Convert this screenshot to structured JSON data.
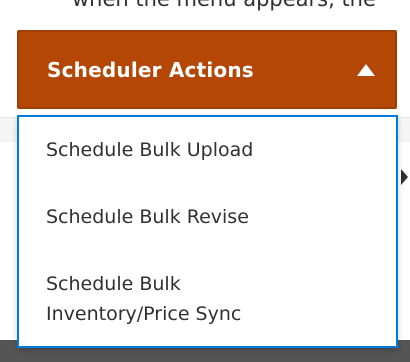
{
  "background": {
    "top_text": "when the menu appears, the"
  },
  "scheduler": {
    "button_label": "Scheduler Actions",
    "arrow_icon": "triangle-up-icon",
    "accent_color": "#b54706",
    "dropdown_border_color": "#007bdb",
    "menu_items": [
      {
        "label_line1": "Schedule Bulk Upload"
      },
      {
        "label_line1": "Schedule Bulk Revise"
      },
      {
        "label_line1": "Schedule Bulk",
        "label_line2": "Inventory/Price Sync"
      }
    ]
  }
}
